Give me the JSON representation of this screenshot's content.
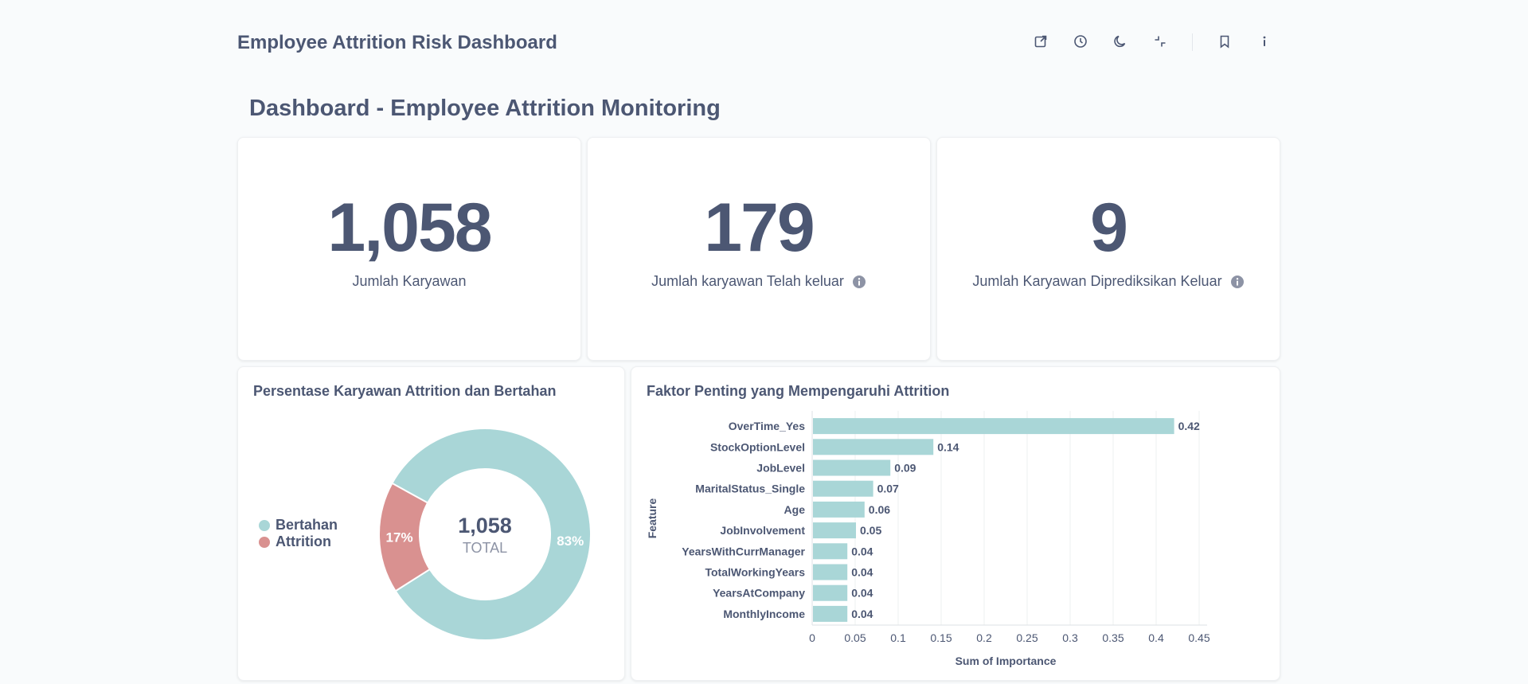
{
  "header": {
    "title": "Employee Attrition Risk Dashboard",
    "actions": [
      {
        "name": "share",
        "icon": "external-link-icon"
      },
      {
        "name": "history",
        "icon": "clock-icon"
      },
      {
        "name": "night-mode",
        "icon": "moon-icon"
      },
      {
        "name": "exit-fullscreen",
        "icon": "collapse-icon"
      },
      {
        "name": "bookmark",
        "icon": "bookmark-icon"
      },
      {
        "name": "info",
        "icon": "info-icon"
      }
    ]
  },
  "section": {
    "heading": "Dashboard - Employee Attrition Monitoring"
  },
  "kpis": [
    {
      "value": "1,058",
      "label": "Jumlah Karyawan",
      "has_info": false
    },
    {
      "value": "179",
      "label": "Jumlah karyawan Telah keluar",
      "has_info": true
    },
    {
      "value": "9",
      "label": "Jumlah Karyawan Diprediksikan Keluar",
      "has_info": true
    }
  ],
  "colors": {
    "teal": "#a9d6d7",
    "red": "#d99190",
    "text": "#4c5773",
    "muted": "#8d93a5"
  },
  "donut": {
    "title": "Persentase Karyawan Attrition dan Bertahan",
    "center_value": "1,058",
    "center_label": "TOTAL",
    "legend": [
      {
        "label": "Bertahan",
        "color": "#a9d6d7"
      },
      {
        "label": "Attrition",
        "color": "#d99190"
      }
    ]
  },
  "bar_chart": {
    "title": "Faktor Penting yang Mempengaruhi Attrition",
    "xlabel": "Sum of Importance",
    "ylabel": "Feature"
  },
  "chart_data": [
    {
      "type": "pie",
      "title": "Persentase Karyawan Attrition dan Bertahan",
      "categories": [
        "Bertahan",
        "Attrition"
      ],
      "values": [
        83,
        17
      ],
      "labels": [
        "83%",
        "17%"
      ],
      "total": "1,058",
      "colors": [
        "#a9d6d7",
        "#d99190"
      ],
      "legend": "left"
    },
    {
      "type": "bar",
      "orientation": "horizontal",
      "title": "Faktor Penting yang Mempengaruhi Attrition",
      "categories": [
        "OverTime_Yes",
        "StockOptionLevel",
        "JobLevel",
        "MaritalStatus_Single",
        "Age",
        "JobInvolvement",
        "YearsWithCurrManager",
        "TotalWorkingYears",
        "YearsAtCompany",
        "MonthlyIncome"
      ],
      "values": [
        0.42,
        0.14,
        0.09,
        0.07,
        0.06,
        0.05,
        0.04,
        0.04,
        0.04,
        0.04
      ],
      "value_labels": [
        "0.42",
        "0.14",
        "0.09",
        "0.07",
        "0.06",
        "0.05",
        "0.04",
        "0.04",
        "0.04",
        "0.04"
      ],
      "xlabel": "Sum of Importance",
      "ylabel": "Feature",
      "xlim": [
        0,
        0.45
      ],
      "xticks": [
        "0",
        "0.05",
        "0.1",
        "0.15",
        "0.2",
        "0.25",
        "0.3",
        "0.35",
        "0.4",
        "0.45"
      ],
      "grid": true,
      "color": "#a9d6d7"
    }
  ]
}
